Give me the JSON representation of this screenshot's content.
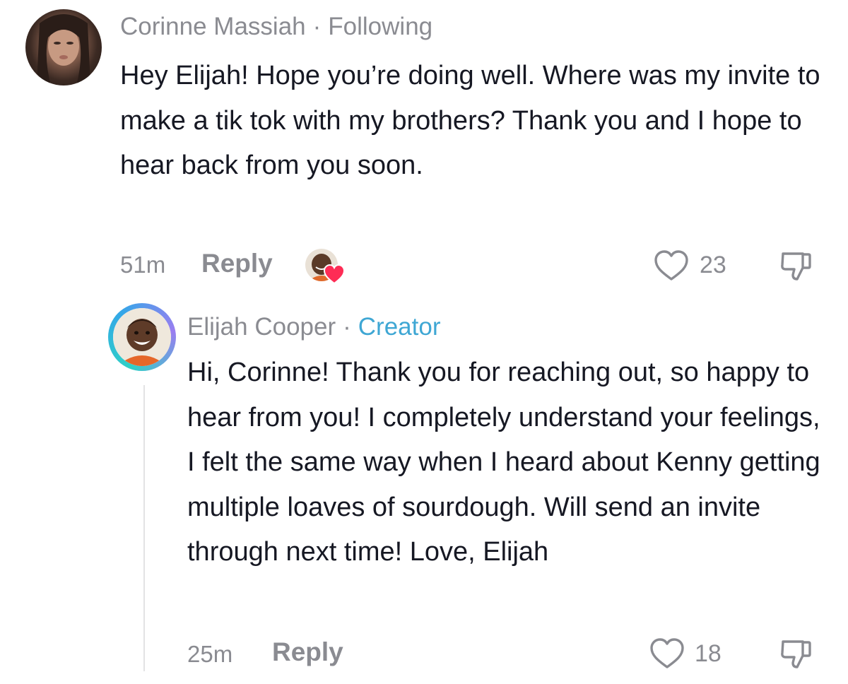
{
  "comment": {
    "author": "Corinne Massiah",
    "separator": "·",
    "relation": "Following",
    "text": "Hey Elijah! Hope you’re doing well. Where was my invite to make a tik tok with my brothers? Thank you and I hope to hear back from you soon.",
    "time": "51m",
    "reply_label": "Reply",
    "like_count": "23",
    "liked_by_creator": true
  },
  "reply": {
    "author": "Elijah Cooper",
    "separator": "·",
    "badge": "Creator",
    "text": "Hi, Corinne! Thank you for reaching out, so happy to hear from you! I completely understand your feelings, I felt the same way when I heard about Kenny getting multiple loaves of sourdough. Will send an invite through next time! Love, Elijah",
    "time": "25m",
    "reply_label": "Reply",
    "like_count": "18"
  },
  "colors": {
    "text": "#161823",
    "muted": "#8a8b91",
    "creator": "#3fa7d4",
    "heart": "#fe2c55"
  }
}
